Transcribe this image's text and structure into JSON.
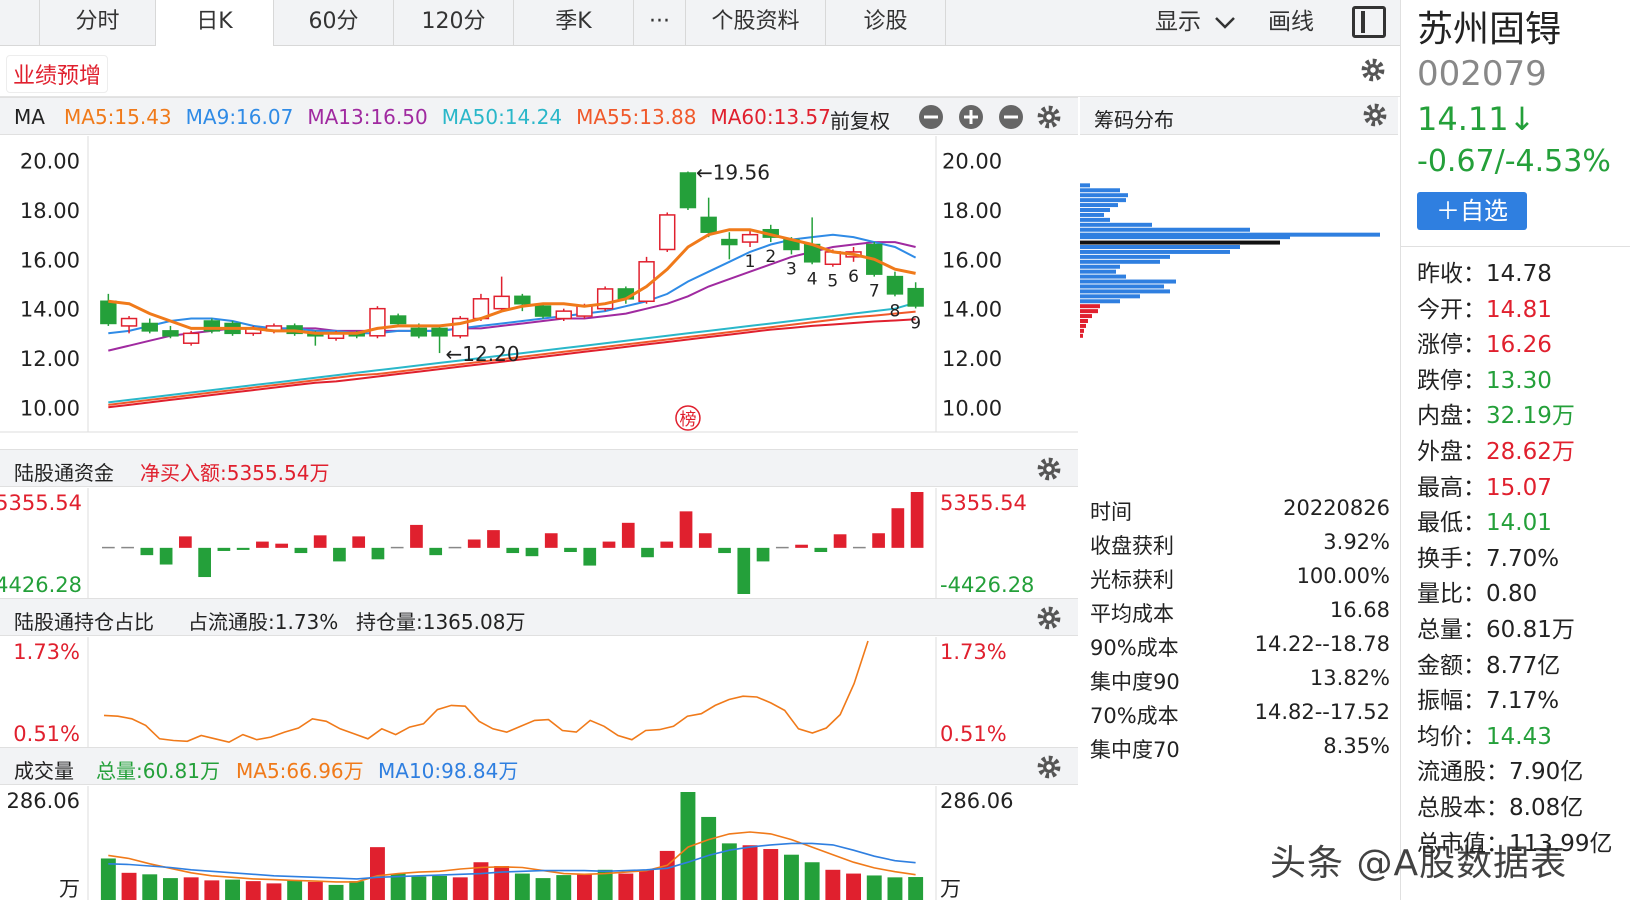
{
  "tabs": [
    "分时",
    "日K",
    "60分",
    "120分",
    "季K",
    "···",
    "个股资料",
    "诊股"
  ],
  "active_tab": 1,
  "toolbar": {
    "display_label": "显示",
    "draw_label": "画线"
  },
  "badge": "业绩预增",
  "ma_header": {
    "label": "MA",
    "items": [
      {
        "text": "MA5:15.43",
        "color": "#f07a1a"
      },
      {
        "text": "MA9:16.07",
        "color": "#2f8be6"
      },
      {
        "text": "MA13:16.50",
        "color": "#a02aa0"
      },
      {
        "text": "MA50:14.24",
        "color": "#2ab7c9"
      },
      {
        "text": "MA55:13.88",
        "color": "#f0582a"
      },
      {
        "text": "MA60:13.57",
        "color": "#e0202e"
      }
    ],
    "adjust_label": "前复权"
  },
  "chips_title": "筹码分布",
  "kline": {
    "y_ticks": [
      "20.00",
      "18.00",
      "16.00",
      "14.00",
      "12.00",
      "10.00"
    ],
    "ylim": [
      9,
      21
    ],
    "high_label": "←19.56",
    "low_label": "←12.20",
    "marker": "榜",
    "candles": [
      {
        "o": 14.3,
        "c": 13.4,
        "h": 14.6,
        "l": 13.3
      },
      {
        "o": 13.3,
        "c": 13.6,
        "h": 13.7,
        "l": 13.0
      },
      {
        "o": 13.4,
        "c": 13.1,
        "h": 13.6,
        "l": 13.0
      },
      {
        "o": 13.1,
        "c": 12.9,
        "h": 13.3,
        "l": 12.8
      },
      {
        "o": 12.6,
        "c": 13.0,
        "h": 13.1,
        "l": 12.5
      },
      {
        "o": 13.5,
        "c": 13.1,
        "h": 13.6,
        "l": 13.0
      },
      {
        "o": 13.4,
        "c": 13.0,
        "h": 13.5,
        "l": 12.9
      },
      {
        "o": 13.0,
        "c": 13.2,
        "h": 13.3,
        "l": 12.9
      },
      {
        "o": 13.1,
        "c": 13.3,
        "h": 13.4,
        "l": 13.0
      },
      {
        "o": 13.3,
        "c": 13.0,
        "h": 13.4,
        "l": 12.9
      },
      {
        "o": 13.0,
        "c": 12.9,
        "h": 13.1,
        "l": 12.5
      },
      {
        "o": 12.8,
        "c": 13.0,
        "h": 13.1,
        "l": 12.7
      },
      {
        "o": 13.0,
        "c": 12.9,
        "h": 13.1,
        "l": 12.8
      },
      {
        "o": 12.9,
        "c": 14.0,
        "h": 14.1,
        "l": 12.8
      },
      {
        "o": 13.7,
        "c": 13.4,
        "h": 13.8,
        "l": 13.3
      },
      {
        "o": 13.2,
        "c": 12.9,
        "h": 13.4,
        "l": 12.8
      },
      {
        "o": 13.2,
        "c": 12.9,
        "h": 13.3,
        "l": 12.2
      },
      {
        "o": 12.9,
        "c": 13.6,
        "h": 13.7,
        "l": 12.8
      },
      {
        "o": 13.6,
        "c": 14.4,
        "h": 14.6,
        "l": 13.5
      },
      {
        "o": 14.0,
        "c": 14.5,
        "h": 15.3,
        "l": 13.9
      },
      {
        "o": 14.5,
        "c": 14.2,
        "h": 14.6,
        "l": 13.9
      },
      {
        "o": 14.1,
        "c": 13.7,
        "h": 14.2,
        "l": 13.6
      },
      {
        "o": 13.6,
        "c": 13.9,
        "h": 14.0,
        "l": 13.5
      },
      {
        "o": 13.7,
        "c": 14.1,
        "h": 14.2,
        "l": 13.6
      },
      {
        "o": 14.0,
        "c": 14.8,
        "h": 14.9,
        "l": 13.9
      },
      {
        "o": 14.8,
        "c": 14.4,
        "h": 14.9,
        "l": 14.2
      },
      {
        "o": 14.3,
        "c": 15.9,
        "h": 16.1,
        "l": 14.2
      },
      {
        "o": 16.4,
        "c": 17.8,
        "h": 17.9,
        "l": 16.3
      },
      {
        "o": 19.5,
        "c": 18.1,
        "h": 19.56,
        "l": 18.0
      },
      {
        "o": 17.7,
        "c": 17.1,
        "h": 18.5,
        "l": 16.9
      },
      {
        "o": 16.8,
        "c": 16.6,
        "h": 17.1,
        "l": 16.0
      },
      {
        "o": 16.7,
        "c": 17.0,
        "h": 17.2,
        "l": 16.5
      },
      {
        "o": 17.2,
        "c": 16.9,
        "h": 17.4,
        "l": 16.7
      },
      {
        "o": 16.8,
        "c": 16.4,
        "h": 16.9,
        "l": 16.2
      },
      {
        "o": 16.6,
        "c": 15.9,
        "h": 17.7,
        "l": 15.8
      },
      {
        "o": 15.8,
        "c": 16.3,
        "h": 16.4,
        "l": 15.7
      },
      {
        "o": 16.1,
        "c": 16.3,
        "h": 16.5,
        "l": 15.9
      },
      {
        "o": 16.6,
        "c": 15.4,
        "h": 16.7,
        "l": 15.3
      },
      {
        "o": 15.3,
        "c": 14.6,
        "h": 15.5,
        "l": 14.5
      },
      {
        "o": 14.81,
        "c": 14.11,
        "h": 15.07,
        "l": 14.01
      }
    ],
    "numbers": [
      "1",
      "2",
      "3",
      "4",
      "5",
      "6",
      "7",
      "8",
      "9"
    ],
    "ma5": [
      14.3,
      14.2,
      13.8,
      13.5,
      13.2,
      13.2,
      13.2,
      13.2,
      13.1,
      13.1,
      13.0,
      13.0,
      13.0,
      13.2,
      13.3,
      13.3,
      13.3,
      13.4,
      13.6,
      13.9,
      14.1,
      14.2,
      14.2,
      14.1,
      14.2,
      14.4,
      14.9,
      15.6,
      16.5,
      17.0,
      17.2,
      17.2,
      17.0,
      16.8,
      16.6,
      16.3,
      16.2,
      16.0,
      15.6,
      15.43
    ],
    "ma9": [
      13.0,
      13.1,
      13.3,
      13.5,
      13.6,
      13.6,
      13.5,
      13.3,
      13.2,
      13.2,
      13.1,
      13.1,
      13.0,
      13.0,
      13.1,
      13.1,
      13.1,
      13.2,
      13.3,
      13.4,
      13.5,
      13.6,
      13.7,
      13.8,
      13.9,
      14.1,
      14.3,
      14.6,
      15.1,
      15.5,
      15.9,
      16.3,
      16.6,
      16.8,
      16.9,
      17.0,
      16.9,
      16.7,
      16.5,
      16.07
    ],
    "ma13": [
      12.3,
      12.5,
      12.7,
      12.9,
      13.0,
      13.1,
      13.2,
      13.2,
      13.2,
      13.2,
      13.2,
      13.1,
      13.1,
      13.1,
      13.1,
      13.1,
      13.1,
      13.2,
      13.2,
      13.3,
      13.4,
      13.5,
      13.6,
      13.6,
      13.7,
      13.8,
      14.0,
      14.2,
      14.5,
      14.9,
      15.2,
      15.5,
      15.8,
      16.1,
      16.3,
      16.5,
      16.6,
      16.7,
      16.7,
      16.5
    ],
    "ma50": [
      10.2,
      10.3,
      10.4,
      10.5,
      10.6,
      10.7,
      10.8,
      10.9,
      11.0,
      11.1,
      11.2,
      11.3,
      11.4,
      11.5,
      11.6,
      11.7,
      11.8,
      11.9,
      12.0,
      12.1,
      12.2,
      12.3,
      12.4,
      12.5,
      12.6,
      12.7,
      12.8,
      12.9,
      13.0,
      13.1,
      13.2,
      13.3,
      13.4,
      13.5,
      13.6,
      13.7,
      13.8,
      13.9,
      14.0,
      14.24
    ],
    "ma55": [
      10.1,
      10.2,
      10.3,
      10.4,
      10.5,
      10.6,
      10.7,
      10.8,
      10.9,
      11.0,
      11.1,
      11.2,
      11.3,
      11.35,
      11.45,
      11.55,
      11.65,
      11.75,
      11.85,
      11.95,
      12.05,
      12.15,
      12.25,
      12.35,
      12.45,
      12.55,
      12.65,
      12.75,
      12.85,
      12.95,
      13.05,
      13.15,
      13.25,
      13.35,
      13.45,
      13.55,
      13.65,
      13.72,
      13.8,
      13.88
    ],
    "ma60": [
      10.0,
      10.1,
      10.2,
      10.3,
      10.4,
      10.5,
      10.6,
      10.7,
      10.8,
      10.9,
      11.0,
      11.05,
      11.15,
      11.25,
      11.35,
      11.45,
      11.55,
      11.65,
      11.75,
      11.85,
      11.95,
      12.05,
      12.15,
      12.25,
      12.35,
      12.45,
      12.55,
      12.65,
      12.75,
      12.85,
      12.95,
      13.05,
      13.15,
      13.22,
      13.3,
      13.36,
      13.42,
      13.48,
      13.52,
      13.57
    ]
  },
  "hk_flow": {
    "title": "陆股通资金",
    "net_label": "净买入额:5355.54万",
    "top": "5355.54",
    "bottom": "-4426.28",
    "ylim": [
      -4426.28,
      5355.54
    ],
    "values": [
      0,
      0,
      -700,
      -1600,
      1100,
      -2800,
      -300,
      -200,
      600,
      400,
      -500,
      1200,
      -1300,
      1100,
      -1100,
      0,
      2200,
      -700,
      0,
      800,
      1700,
      -500,
      -800,
      1400,
      -400,
      -1700,
      600,
      2400,
      -900,
      600,
      3500,
      1400,
      -500,
      -4426.28,
      -1300,
      0,
      300,
      -400,
      1300,
      0,
      1400,
      3800,
      5355.54
    ]
  },
  "hk_hold": {
    "title": "陆股通持仓占比",
    "pct_label": "占流通股:1.73%",
    "vol_label": "持仓量:1365.08万",
    "top": "1.73%",
    "bottom": "0.51%",
    "ylim": [
      0.51,
      1.73
    ],
    "values": [
      0.84,
      0.83,
      0.8,
      0.72,
      0.56,
      0.54,
      0.53,
      0.6,
      0.56,
      0.52,
      0.61,
      0.55,
      0.58,
      0.64,
      0.69,
      0.8,
      0.77,
      0.68,
      0.62,
      0.56,
      0.68,
      0.61,
      0.7,
      0.74,
      0.91,
      0.96,
      0.95,
      0.77,
      0.68,
      0.64,
      0.71,
      0.78,
      0.79,
      0.66,
      0.64,
      0.78,
      0.71,
      0.6,
      0.55,
      0.66,
      0.67,
      0.71,
      0.83,
      0.86,
      0.96,
      1.03,
      1.07,
      1.06,
      0.99,
      0.9,
      0.68,
      0.63,
      0.69,
      0.85,
      1.22,
      1.73
    ]
  },
  "volume": {
    "title": "成交量",
    "total_label": "总量:60.81万",
    "ma5_label": "MA5:66.96万",
    "ma10_label": "MA10:98.84万",
    "top": "286.06",
    "unit": "万",
    "ylim": [
      0,
      286.06
    ],
    "bars": [
      {
        "v": 110,
        "up": false
      },
      {
        "v": 72,
        "up": true
      },
      {
        "v": 68,
        "up": false
      },
      {
        "v": 58,
        "up": false
      },
      {
        "v": 60,
        "up": true
      },
      {
        "v": 52,
        "up": true
      },
      {
        "v": 54,
        "up": false
      },
      {
        "v": 50,
        "up": true
      },
      {
        "v": 44,
        "up": true
      },
      {
        "v": 52,
        "up": false
      },
      {
        "v": 48,
        "up": true
      },
      {
        "v": 40,
        "up": false
      },
      {
        "v": 50,
        "up": false
      },
      {
        "v": 140,
        "up": true
      },
      {
        "v": 70,
        "up": false
      },
      {
        "v": 62,
        "up": false
      },
      {
        "v": 64,
        "up": false
      },
      {
        "v": 60,
        "up": true
      },
      {
        "v": 100,
        "up": true
      },
      {
        "v": 90,
        "up": true
      },
      {
        "v": 70,
        "up": false
      },
      {
        "v": 58,
        "up": false
      },
      {
        "v": 66,
        "up": false
      },
      {
        "v": 70,
        "up": true
      },
      {
        "v": 80,
        "up": false
      },
      {
        "v": 70,
        "up": true
      },
      {
        "v": 80,
        "up": true
      },
      {
        "v": 130,
        "up": true
      },
      {
        "v": 286.06,
        "up": false
      },
      {
        "v": 220,
        "up": false
      },
      {
        "v": 150,
        "up": false
      },
      {
        "v": 145,
        "up": true
      },
      {
        "v": 135,
        "up": true
      },
      {
        "v": 120,
        "up": false
      },
      {
        "v": 100,
        "up": false
      },
      {
        "v": 80,
        "up": true
      },
      {
        "v": 70,
        "up": true
      },
      {
        "v": 65,
        "up": false
      },
      {
        "v": 60,
        "up": false
      },
      {
        "v": 60.81,
        "up": false
      }
    ],
    "ma5": [
      118,
      110,
      96,
      84,
      72,
      64,
      60,
      56,
      54,
      52,
      50,
      48,
      48,
      64,
      70,
      74,
      76,
      82,
      86,
      88,
      86,
      78,
      70,
      68,
      70,
      74,
      78,
      92,
      140,
      160,
      175,
      180,
      175,
      160,
      140,
      120,
      100,
      85,
      75,
      66.96
    ],
    "ma10": [
      96,
      94,
      90,
      86,
      80,
      76,
      72,
      68,
      64,
      62,
      60,
      58,
      56,
      60,
      62,
      64,
      66,
      68,
      70,
      74,
      76,
      78,
      78,
      78,
      76,
      78,
      80,
      84,
      100,
      118,
      132,
      140,
      146,
      150,
      150,
      146,
      132,
      116,
      104,
      98.84
    ]
  },
  "chips": {
    "time_label": "时间",
    "time": "20220826",
    "rows": [
      {
        "k": "收盘获利",
        "v": "3.92%"
      },
      {
        "k": "光标获利",
        "v": "100.00%"
      },
      {
        "k": "平均成本",
        "v": "16.68"
      },
      {
        "k": "90%成本",
        "v": "14.22--18.78"
      },
      {
        "k": "集中度90",
        "v": "13.82%"
      },
      {
        "k": "70%成本",
        "v": "14.82--17.52"
      },
      {
        "k": "集中度70",
        "v": "8.35%"
      }
    ],
    "bars": [
      {
        "p": 19.0,
        "w": 10,
        "t": "b"
      },
      {
        "p": 18.8,
        "w": 40,
        "t": "b"
      },
      {
        "p": 18.6,
        "w": 48,
        "t": "b"
      },
      {
        "p": 18.4,
        "w": 46,
        "t": "b"
      },
      {
        "p": 18.2,
        "w": 38,
        "t": "b"
      },
      {
        "p": 18.0,
        "w": 30,
        "t": "b"
      },
      {
        "p": 17.8,
        "w": 24,
        "t": "b"
      },
      {
        "p": 17.6,
        "w": 30,
        "t": "b"
      },
      {
        "p": 17.4,
        "w": 72,
        "t": "b"
      },
      {
        "p": 17.2,
        "w": 170,
        "t": "b"
      },
      {
        "p": 17.0,
        "w": 300,
        "t": "b"
      },
      {
        "p": 16.9,
        "w": 210,
        "t": "b"
      },
      {
        "p": 16.68,
        "w": 200,
        "t": "k"
      },
      {
        "p": 16.5,
        "w": 160,
        "t": "b"
      },
      {
        "p": 16.3,
        "w": 150,
        "t": "b"
      },
      {
        "p": 16.1,
        "w": 90,
        "t": "b"
      },
      {
        "p": 15.9,
        "w": 80,
        "t": "b"
      },
      {
        "p": 15.7,
        "w": 40,
        "t": "b"
      },
      {
        "p": 15.5,
        "w": 36,
        "t": "b"
      },
      {
        "p": 15.3,
        "w": 46,
        "t": "b"
      },
      {
        "p": 15.1,
        "w": 96,
        "t": "b"
      },
      {
        "p": 14.9,
        "w": 84,
        "t": "b"
      },
      {
        "p": 14.7,
        "w": 90,
        "t": "b"
      },
      {
        "p": 14.5,
        "w": 60,
        "t": "b"
      },
      {
        "p": 14.3,
        "w": 40,
        "t": "b"
      },
      {
        "p": 14.1,
        "w": 20,
        "t": "r"
      },
      {
        "p": 13.9,
        "w": 18,
        "t": "r"
      },
      {
        "p": 13.7,
        "w": 12,
        "t": "r"
      },
      {
        "p": 13.5,
        "w": 8,
        "t": "r"
      },
      {
        "p": 13.3,
        "w": 6,
        "t": "r"
      },
      {
        "p": 13.1,
        "w": 4,
        "t": "r"
      },
      {
        "p": 12.9,
        "w": 3,
        "t": "r"
      }
    ]
  },
  "stock": {
    "name": "苏州固锝",
    "code": "002079",
    "price": "14.11↓",
    "change": "-0.67/-4.53%",
    "add_label": "＋自选"
  },
  "stats": [
    {
      "k": "昨收：",
      "v": "14.78",
      "c": "#222"
    },
    {
      "k": "今开：",
      "v": "14.81",
      "c": "#e0202e"
    },
    {
      "k": "涨停：",
      "v": "16.26",
      "c": "#e0202e"
    },
    {
      "k": "跌停：",
      "v": "13.30",
      "c": "#24a03a"
    },
    {
      "k": "内盘：",
      "v": "32.19万",
      "c": "#24a03a"
    },
    {
      "k": "外盘：",
      "v": "28.62万",
      "c": "#e0202e"
    },
    {
      "k": "最高：",
      "v": "15.07",
      "c": "#e0202e"
    },
    {
      "k": "最低：",
      "v": "14.01",
      "c": "#24a03a"
    },
    {
      "k": "换手：",
      "v": "7.70%",
      "c": "#222"
    },
    {
      "k": "量比：",
      "v": "0.80",
      "c": "#222"
    },
    {
      "k": "总量：",
      "v": "60.81万",
      "c": "#222"
    },
    {
      "k": "金额：",
      "v": "8.77亿",
      "c": "#222"
    },
    {
      "k": "振幅：",
      "v": "7.17%",
      "c": "#222"
    },
    {
      "k": "均价：",
      "v": "14.43",
      "c": "#24a03a"
    },
    {
      "k": "流通股：",
      "v": "7.90亿",
      "c": "#222"
    },
    {
      "k": "总股本：",
      "v": "8.08亿",
      "c": "#222"
    },
    {
      "k": "总市值：",
      "v": "113.99亿",
      "c": "#222"
    }
  ],
  "watermark": "头条 @A股数据表",
  "colors": {
    "up": "#e0202e",
    "down": "#24a03a",
    "blue": "#2f7fe0"
  }
}
